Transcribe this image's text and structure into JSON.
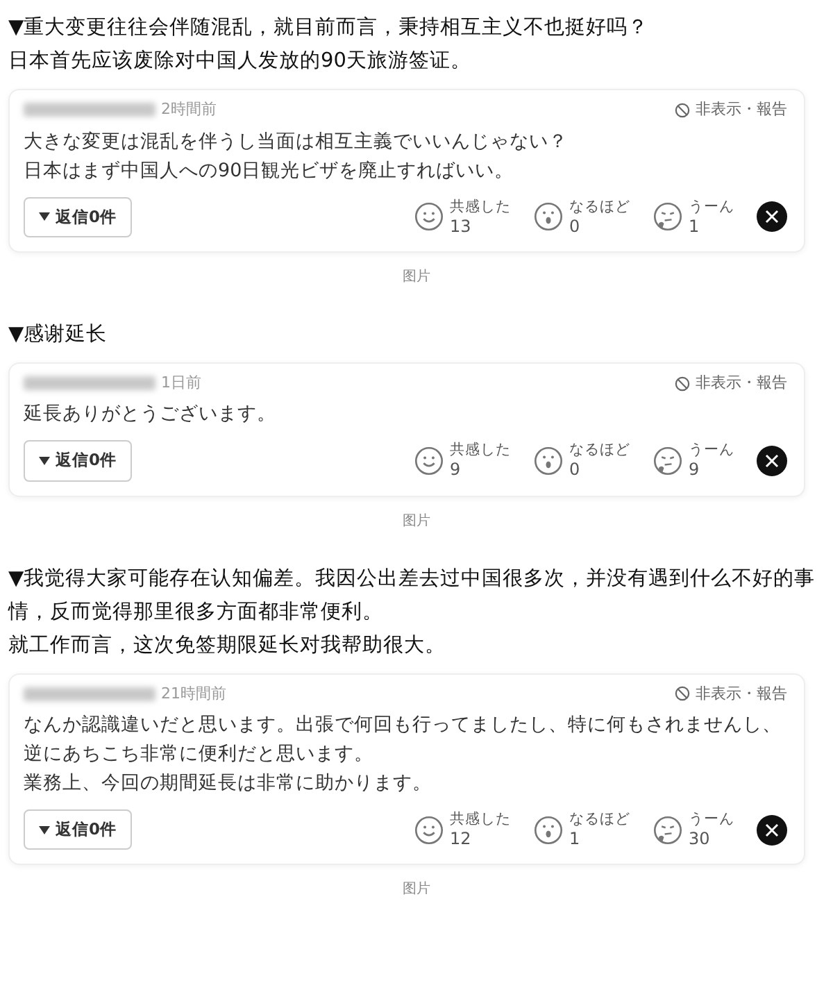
{
  "sections": [
    {
      "intro": [
        "▼重大变更往往会伴随混乱，就目前而言，秉持相互主义不也挺好吗？",
        "日本首先应该废除对中国人发放的90天旅游签证。"
      ],
      "comment": {
        "time": "2時間前",
        "hide_report": "非表示・報告",
        "body": [
          "大きな変更は混乱を伴うし当面は相互主義でいいんじゃない？",
          "日本はまず中国人への90日観光ビザを廃止すればいい。"
        ],
        "reply_button": "返信0件",
        "reactions": [
          {
            "kind": "smile",
            "label": "共感した",
            "count": "13"
          },
          {
            "kind": "surprise",
            "label": "なるほど",
            "count": "0"
          },
          {
            "kind": "hmm",
            "label": "うーん",
            "count": "1"
          }
        ]
      },
      "caption": "图片"
    },
    {
      "intro": [
        "▼感谢延长"
      ],
      "comment": {
        "time": "1日前",
        "hide_report": "非表示・報告",
        "body": [
          "延長ありがとうございます。"
        ],
        "reply_button": "返信0件",
        "reactions": [
          {
            "kind": "smile",
            "label": "共感した",
            "count": "9"
          },
          {
            "kind": "surprise",
            "label": "なるほど",
            "count": "0"
          },
          {
            "kind": "hmm",
            "label": "うーん",
            "count": "9"
          }
        ]
      },
      "caption": "图片"
    },
    {
      "intro": [
        "▼我觉得大家可能存在认知偏差。我因公出差去过中国很多次，并没有遇到什么不好的事情，反而觉得那里很多方面都非常便利。",
        "就工作而言，这次免签期限延长对我帮助很大。"
      ],
      "comment": {
        "time": "21時間前",
        "hide_report": "非表示・報告",
        "body": [
          "なんか認識違いだと思います。出張で何回も行ってましたし、特に何もされませんし、",
          "逆にあちこち非常に便利だと思います。",
          "業務上、今回の期間延長は非常に助かります。"
        ],
        "reply_button": "返信0件",
        "reactions": [
          {
            "kind": "smile",
            "label": "共感した",
            "count": "12"
          },
          {
            "kind": "surprise",
            "label": "なるほど",
            "count": "1"
          },
          {
            "kind": "hmm",
            "label": "うーん",
            "count": "30"
          }
        ]
      },
      "caption": "图片"
    }
  ]
}
